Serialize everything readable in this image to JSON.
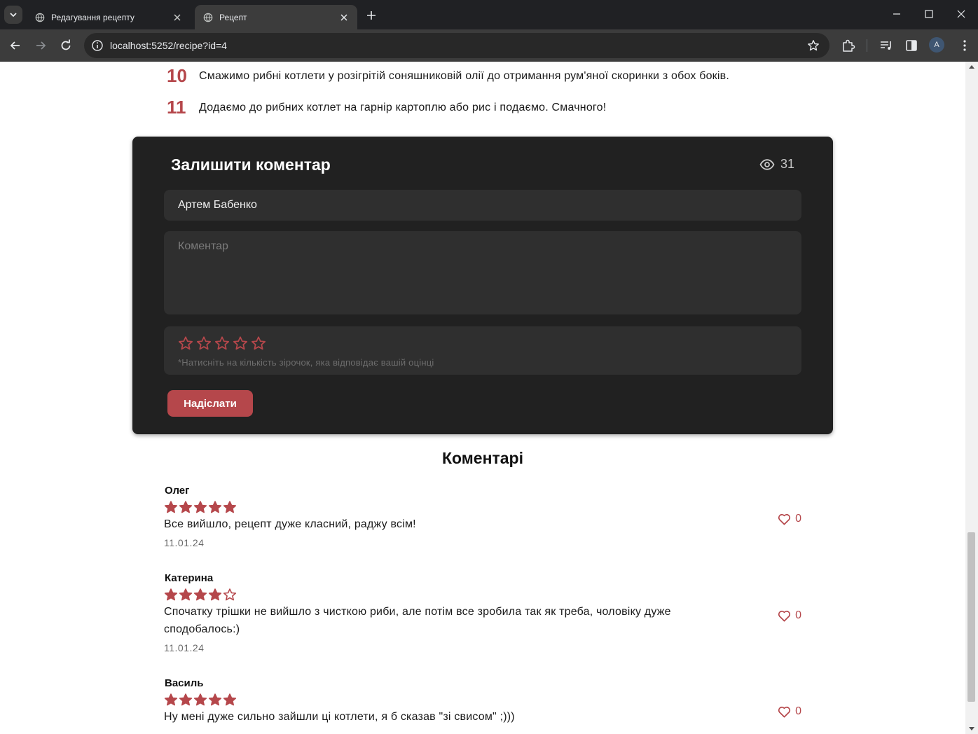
{
  "browser": {
    "tabs": [
      {
        "title": "Редагування рецепту",
        "active": false
      },
      {
        "title": "Рецепт",
        "active": true
      }
    ],
    "url": "localhost:5252/recipe?id=4",
    "profile_initial": "A"
  },
  "steps": [
    {
      "num": "10",
      "text": "Смажимо рибні котлети у розігрітій соняшниковій олії до отримання рум'яної скоринки з обох боків."
    },
    {
      "num": "11",
      "text": "Додаємо до рибних котлет на гарнір картоплю або рис і подаємо. Смачного!"
    }
  ],
  "comment_form": {
    "title": "Залишити коментар",
    "views": "31",
    "name_value": "Артем Бабенко",
    "comment_placeholder": "Коментар",
    "rating": 0,
    "rating_max": 5,
    "rating_hint": "*Натисніть на кількість зірочок, яка відповідає вашій оцінці",
    "submit_label": "Надіслати"
  },
  "comments_section": {
    "title": "Коментарі",
    "items": [
      {
        "author": "Олег",
        "rating": 5,
        "text": "Все вийшло, рецепт дуже класний, раджу всім!",
        "date": "11.01.24",
        "likes": "0"
      },
      {
        "author": "Катерина",
        "rating": 4,
        "text": "Спочатку трішки не вийшло з чисткою риби, але потім все зробила так як треба, чоловіку дуже сподобалось:)",
        "date": "11.01.24",
        "likes": "0"
      },
      {
        "author": "Василь",
        "rating": 5,
        "text": "Ну мені дуже сильно зайшли ці котлети, я б сказав \"зі свисом\" ;)))",
        "date": "",
        "likes": "0"
      }
    ]
  },
  "colors": {
    "accent": "#b5474b",
    "card_bg": "#212121",
    "field_bg": "#2f2f2f"
  }
}
